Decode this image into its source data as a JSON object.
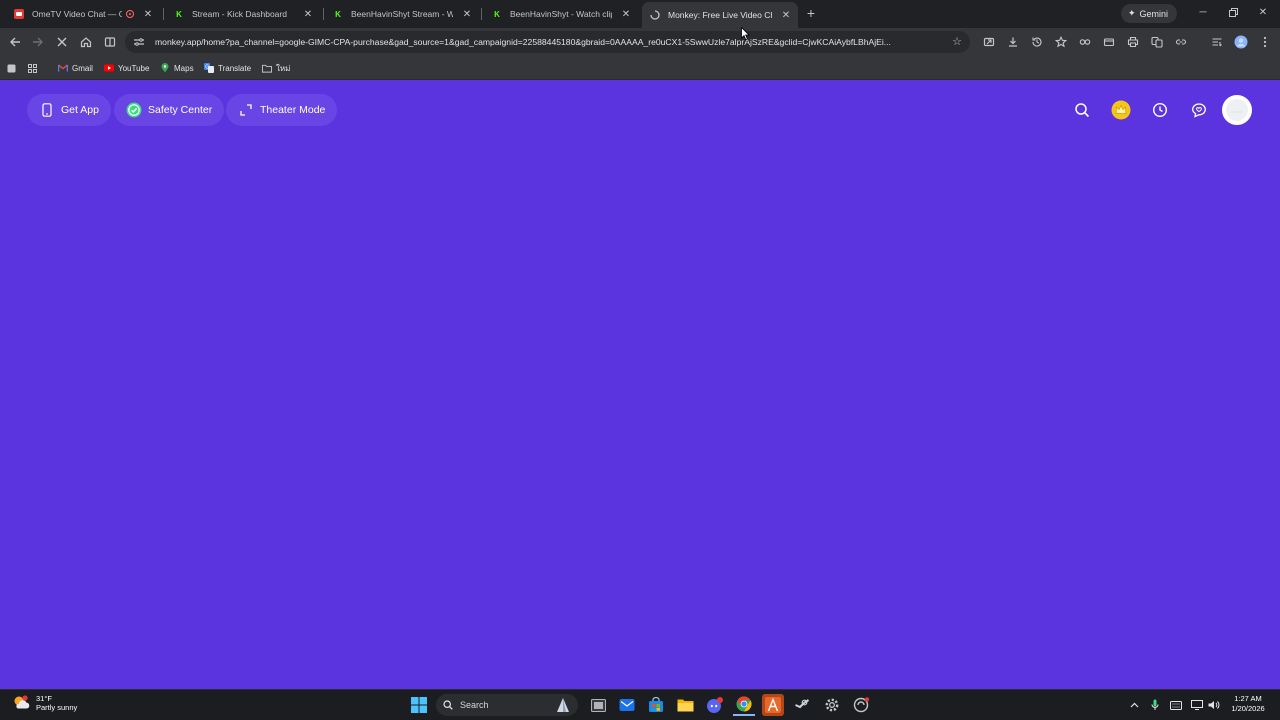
{
  "browser": {
    "tabs": [
      {
        "title": "OmeTV Video Chat — Ome",
        "favicon": "ometv-icon",
        "favicon_color": "#e53935",
        "recording": true,
        "active": false
      },
      {
        "title": "Stream - Kick Dashboard",
        "favicon": "kick-icon",
        "favicon_color": "#53fc18",
        "active": false
      },
      {
        "title": "BeenHavinShyt Stream - Watch",
        "favicon": "kick-icon",
        "favicon_color": "#53fc18",
        "active": false
      },
      {
        "title": "BeenHavinShyt - Watch clips o",
        "favicon": "kick-icon",
        "favicon_color": "#53fc18",
        "active": false
      },
      {
        "title": "Monkey: Free Live Video Chat",
        "favicon": "loading-icon",
        "active": true
      }
    ],
    "new_tab_label": "+",
    "gemini_label": "Gemini",
    "url": "monkey.app/home?pa_channel=google-GIMC-CPA-purchase&gad_source=1&gad_campaignid=22588445180&gbraid=0AAAAA_re0uCX1-5SwwUzle7alprAjSzRE&gclid=CjwKCAiAybfLBhAjEi...",
    "bookmarks": [
      {
        "label": "Gmail",
        "icon": "gmail-icon"
      },
      {
        "label": "YouTube",
        "icon": "youtube-icon"
      },
      {
        "label": "Maps",
        "icon": "maps-icon"
      },
      {
        "label": "Translate",
        "icon": "translate-icon"
      },
      {
        "label": "ใหม่",
        "icon": "folder-icon"
      }
    ]
  },
  "page": {
    "background_color": "#5b33df",
    "buttons": {
      "get_app": "Get App",
      "safety_center": "Safety Center",
      "theater_mode": "Theater Mode"
    },
    "right_icons": [
      "search-icon",
      "crown-icon",
      "history-icon",
      "chat-icon",
      "avatar"
    ]
  },
  "taskbar": {
    "weather": {
      "temp": "31°F",
      "condition": "Partly sunny"
    },
    "search_placeholder": "Search",
    "clock": {
      "time": "1:27 AM",
      "date": "1/20/2026"
    }
  }
}
